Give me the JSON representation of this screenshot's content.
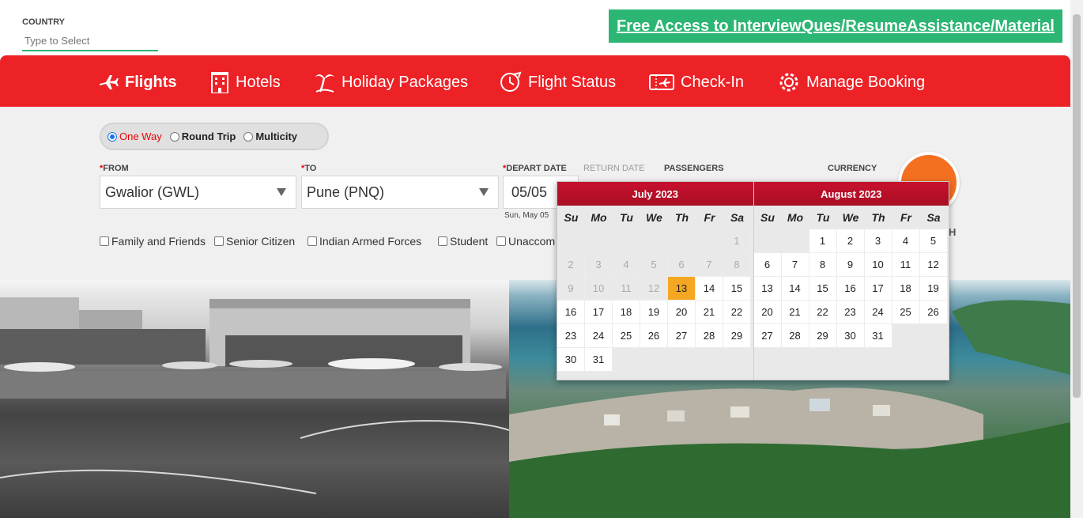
{
  "top": {
    "country_label": "COUNTRY",
    "country_placeholder": "Type to Select",
    "free_access": "Free Access to InterviewQues/ResumeAssistance/Material"
  },
  "nav": {
    "flights": "Flights",
    "hotels": "Hotels",
    "holiday": "Holiday Packages",
    "flight_status": "Flight Status",
    "checkin": "Check-In",
    "manage": "Manage Booking"
  },
  "trip": {
    "one_way": "One Way",
    "round_trip": "Round Trip",
    "multicity": "Multicity",
    "selected": "One Way"
  },
  "form": {
    "from_label": "FROM",
    "to_label": "TO",
    "depart_label": "DEPART DATE",
    "return_label": "RETURN DATE",
    "passengers_label": "PASSENGERS",
    "currency_label": "CURRENCY",
    "required_mark": "*",
    "from_value": "Gwalior (GWL)",
    "to_value": "Pune (PNQ)",
    "depart_value": "05/05",
    "depart_sub": "Sun, May 05",
    "search_trail": "H"
  },
  "concessions": [
    "Family and Friends",
    "Senior Citizen",
    "Indian Armed Forces",
    "Student",
    "Unaccom"
  ],
  "calendar": {
    "dow": [
      "Su",
      "Mo",
      "Tu",
      "We",
      "Th",
      "Fr",
      "Sa"
    ],
    "months": [
      {
        "title": "July 2023",
        "weeks": [
          [
            "",
            "",
            "",
            "",
            "",
            "",
            "1"
          ],
          [
            "2",
            "3",
            "4",
            "5",
            "6",
            "7",
            "8"
          ],
          [
            "9",
            "10",
            "11",
            "12",
            "13",
            "14",
            "15"
          ],
          [
            "16",
            "17",
            "18",
            "19",
            "20",
            "21",
            "22"
          ],
          [
            "23",
            "24",
            "25",
            "26",
            "27",
            "28",
            "29"
          ],
          [
            "30",
            "31",
            "",
            "",
            "",
            "",
            ""
          ]
        ],
        "past_until": 12,
        "highlight": "13"
      },
      {
        "title": "August 2023",
        "weeks": [
          [
            "",
            "",
            "1",
            "2",
            "3",
            "4",
            "5"
          ],
          [
            "6",
            "7",
            "8",
            "9",
            "10",
            "11",
            "12"
          ],
          [
            "13",
            "14",
            "15",
            "16",
            "17",
            "18",
            "19"
          ],
          [
            "20",
            "21",
            "22",
            "23",
            "24",
            "25",
            "26"
          ],
          [
            "27",
            "28",
            "29",
            "30",
            "31",
            "",
            ""
          ]
        ],
        "past_until": 0,
        "highlight": ""
      }
    ]
  },
  "colors": {
    "brand_red": "#ec2227",
    "green": "#2bb673",
    "orange": "#f37021",
    "highlight": "#f5a623"
  }
}
